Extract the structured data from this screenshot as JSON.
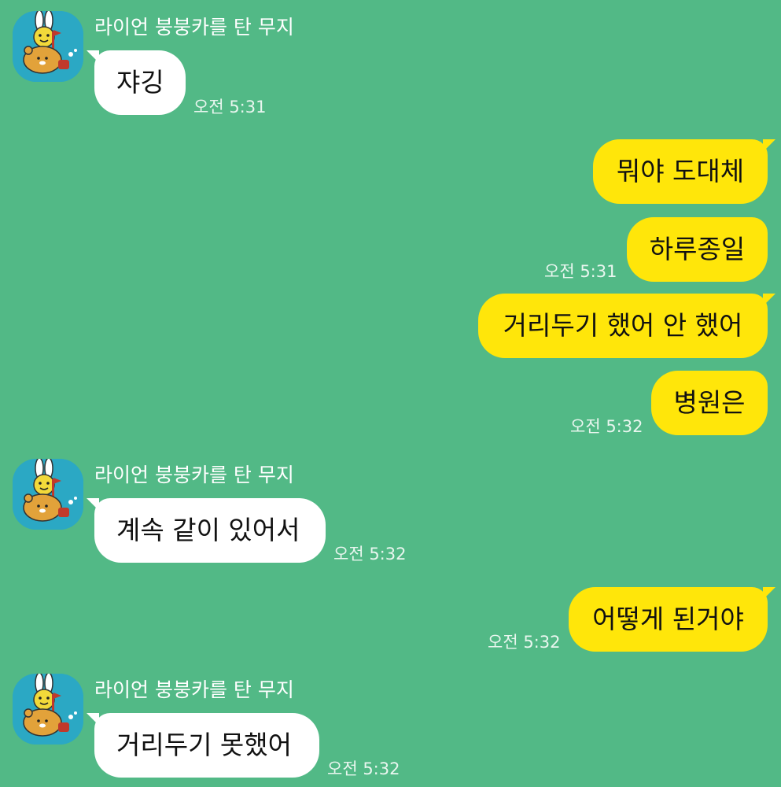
{
  "colors": {
    "background": "#52B986",
    "incoming_bubble": "#FFFFFF",
    "outgoing_bubble": "#FFE60A",
    "avatar_bg": "#2BA8C4"
  },
  "groups": [
    {
      "sender": "라이언 붕붕카를 탄 무지",
      "avatar_icon": "muzi-on-ryan-avatar-icon",
      "messages": [
        {
          "text": "쟈깅"
        }
      ],
      "time": "오전 5:31"
    },
    {
      "sender": "라이언 붕붕카를 탄 무지",
      "avatar_icon": "muzi-on-ryan-avatar-icon",
      "messages": [
        {
          "text": "계속 같이 있어서"
        }
      ],
      "time": "오전 5:32"
    },
    {
      "sender": "라이언 붕붕카를 탄 무지",
      "avatar_icon": "muzi-on-ryan-avatar-icon",
      "messages": [
        {
          "text": "거리두기 못했어"
        }
      ],
      "time": "오전 5:32"
    }
  ],
  "outgoing": [
    {
      "text": "뭐야 도대체"
    },
    {
      "text": "하루종일",
      "time": "오전 5:31"
    },
    {
      "text": "거리두기 했어 안 했어"
    },
    {
      "text": "병원은",
      "time": "오전 5:32"
    },
    {
      "text": "어떻게 된거야",
      "time": "오전 5:32"
    }
  ]
}
